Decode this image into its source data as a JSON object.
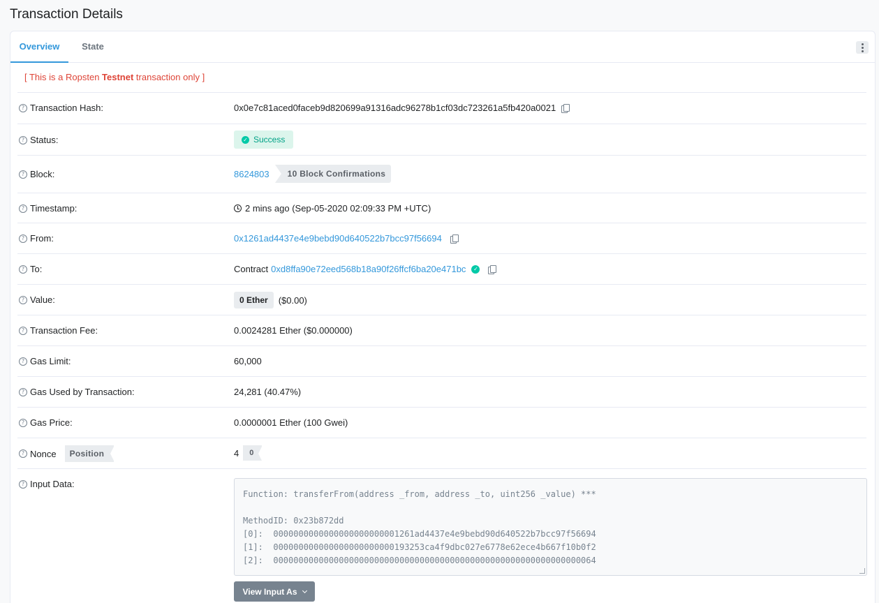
{
  "page": {
    "title": "Transaction Details"
  },
  "tabs": [
    {
      "label": "Overview",
      "active": true
    },
    {
      "label": "State",
      "active": false
    }
  ],
  "notice": {
    "prefix": "[ This is a Ropsten ",
    "emphasis": "Testnet",
    "suffix": " transaction only ]"
  },
  "rows": {
    "tx_hash": {
      "label": "Transaction Hash:",
      "value": "0x0e7c81aced0faceb9d820699a91316adc96278b1cf03dc723261a5fb420a0021"
    },
    "status": {
      "label": "Status:",
      "value": "Success"
    },
    "block": {
      "label": "Block:",
      "number": "8624803",
      "confirmations": "10 Block Confirmations"
    },
    "timestamp": {
      "label": "Timestamp:",
      "value": "2 mins ago (Sep-05-2020 02:09:33 PM +UTC)"
    },
    "from": {
      "label": "From:",
      "address": "0x1261ad4437e4e9bebd90d640522b7bcc97f56694"
    },
    "to": {
      "label": "To:",
      "prefix": "Contract",
      "address": "0xd8ffa90e72eed568b18a90f26ffcf6ba20e471bc"
    },
    "value": {
      "label": "Value:",
      "amount": "0 Ether",
      "usd": "($0.00)"
    },
    "fee": {
      "label": "Transaction Fee:",
      "value": "0.0024281 Ether ($0.000000)"
    },
    "gas_limit": {
      "label": "Gas Limit:",
      "value": "60,000"
    },
    "gas_used": {
      "label": "Gas Used by Transaction:",
      "value": "24,281 (40.47%)"
    },
    "gas_price": {
      "label": "Gas Price:",
      "value": "0.0000001 Ether (100 Gwei)"
    },
    "nonce": {
      "label": "Nonce",
      "position_label": "Position",
      "nonce": "4",
      "position": "0"
    },
    "input": {
      "label": "Input Data:",
      "text": "Function: transferFrom(address _from, address _to, uint256 _value) ***\n\nMethodID: 0x23b872dd\n[0]:  0000000000000000000000001261ad4437e4e9bebd90d640522b7bcc97f56694\n[1]:  000000000000000000000000193253ca4f9dbc027e6778e62ece4b667f10b0f2\n[2]:  0000000000000000000000000000000000000000000000000000000000000064",
      "button_label": "View Input As"
    }
  },
  "colors": {
    "accent": "#3498db",
    "danger": "#de4437",
    "success": "#00c9a7"
  }
}
